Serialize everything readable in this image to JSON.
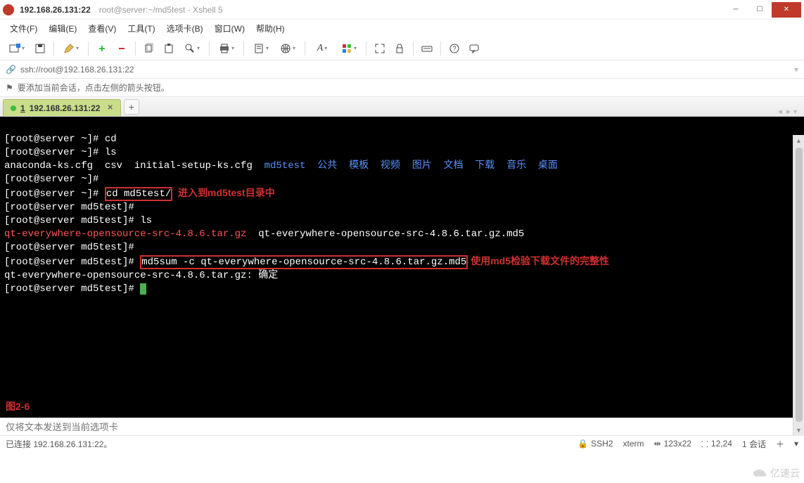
{
  "window": {
    "host": "192.168.26.131:22",
    "path": "root@server:~/md5test - Xshell 5"
  },
  "menu": {
    "file": "文件(F)",
    "edit": "编辑(E)",
    "view": "查看(V)",
    "tools": "工具(T)",
    "tabs": "选项卡(B)",
    "window": "窗口(W)",
    "help": "帮助(H)"
  },
  "address": {
    "url": "ssh://root@192.168.26.131:22"
  },
  "hint": {
    "text": "要添加当前会话，点击左侧的箭头按钮。"
  },
  "tab": {
    "num": "1",
    "label": "192.168.26.131:22"
  },
  "terminal": {
    "l1_prompt": "[root@server ~]# ",
    "l1_cmd": "cd",
    "l2_prompt": "[root@server ~]# ",
    "l2_cmd": "ls",
    "l3_files_a": "anaconda-ks.cfg  csv  initial-setup-ks.cfg  ",
    "l3_md5test": "md5test",
    "l3_cn": "  公共  模板  视频  图片  文档  下载  音乐  桌面",
    "l4_prompt": "[root@server ~]#",
    "l5_prompt": "[root@server ~]# ",
    "l5_cmd": "cd md5test/",
    "l5_ann": "  进入到md5test目录中",
    "l6_prompt": "[root@server md5test]#",
    "l7_prompt": "[root@server md5test]# ",
    "l7_cmd": "ls",
    "l8_red": "qt-everywhere-opensource-src-4.8.6.tar.gz",
    "l8_rest": "  qt-everywhere-opensource-src-4.8.6.tar.gz.md5",
    "l9_prompt": "[root@server md5test]#",
    "l10_prompt": "[root@server md5test]# ",
    "l10_cmd": "md5sum -c qt-everywhere-opensource-src-4.8.6.tar.gz.md5",
    "l10_ann": " 使用md5检验下载文件的完整性",
    "l11": "qt-everywhere-opensource-src-4.8.6.tar.gz: 确定",
    "l12_prompt": "[root@server md5test]# ",
    "figlabel": "图2-6"
  },
  "sendbar": {
    "placeholder": "仅将文本发送到当前选项卡"
  },
  "status": {
    "connected": "已连接 192.168.26.131:22。",
    "ssh_icon": "🔒",
    "ssh": "SSH2",
    "term": "xterm",
    "size_icon": "⇹",
    "size": "123x22",
    "pos_icon": "⸬",
    "pos": "12,24",
    "sessions": "1 会话",
    "add_icon": "＋",
    "menu_icon": "▾"
  },
  "watermark": {
    "text": "亿速云"
  }
}
